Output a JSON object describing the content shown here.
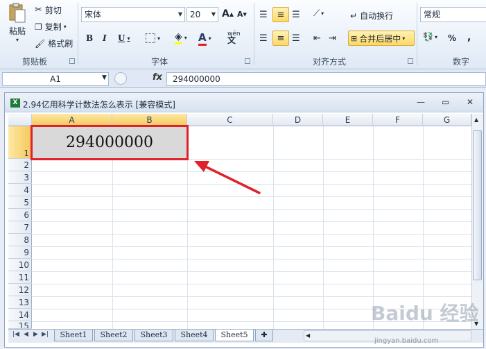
{
  "ribbon": {
    "clipboard": {
      "paste": "粘贴",
      "cut": "剪切",
      "copy": "复制",
      "format_painter": "格式刷",
      "title": "剪贴板"
    },
    "font": {
      "font_name": "宋体",
      "font_size": "20",
      "bold": "B",
      "italic": "I",
      "underline": "U",
      "title": "字体",
      "grow": "A",
      "shrink": "A"
    },
    "alignment": {
      "wrap_text": "自动换行",
      "merge_center": "合并后居中",
      "title": "对齐方式"
    },
    "number": {
      "format": "常规",
      "percent": "%",
      "comma": ",",
      "title": "数字"
    }
  },
  "formula_bar": {
    "name_box": "A1",
    "fx": "fx",
    "content": "294000000"
  },
  "window": {
    "title": "2.94亿用科学计数法怎么表示  [兼容模式]"
  },
  "grid": {
    "columns": [
      "A",
      "B",
      "C",
      "D",
      "E",
      "F",
      "G"
    ],
    "rows": [
      "1",
      "2",
      "3",
      "4",
      "5",
      "6",
      "7",
      "8",
      "9",
      "10",
      "11",
      "12",
      "13",
      "14",
      "15"
    ],
    "cell_A1": "294000000",
    "active_cell": "A1"
  },
  "sheets": {
    "tabs": [
      "Sheet1",
      "Sheet2",
      "Sheet3",
      "Sheet4",
      "Sheet5"
    ],
    "active": "Sheet5"
  },
  "watermark": {
    "brand": "Baidu 经验",
    "url": "jingyan.baidu.com"
  },
  "colors": {
    "highlight": "#e0202a",
    "merged_cell_fill": "#d9d9d9",
    "active_header": "#f5c75a"
  }
}
